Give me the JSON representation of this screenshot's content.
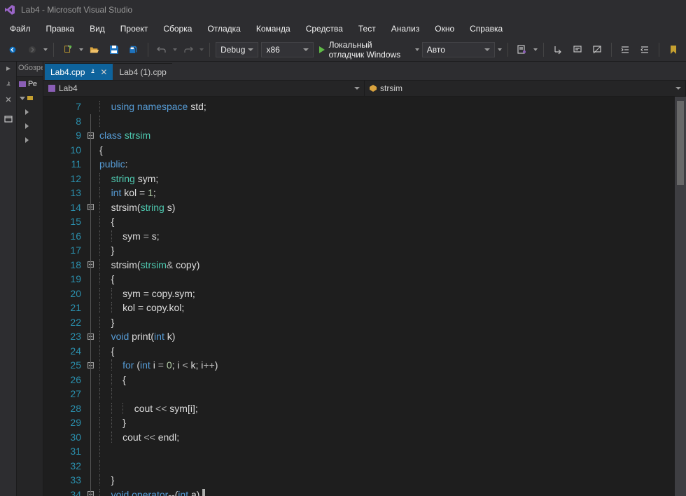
{
  "title": "Lab4 - Microsoft Visual Studio",
  "menu": [
    "Файл",
    "Правка",
    "Вид",
    "Проект",
    "Сборка",
    "Отладка",
    "Команда",
    "Средства",
    "Тест",
    "Анализ",
    "Окно",
    "Справка"
  ],
  "toolbar": {
    "config": "Debug",
    "platform": "x86",
    "debug_label": "Локальный отладчик Windows",
    "auto_label": "Авто"
  },
  "side_labels": {
    "explorer": "Обозре"
  },
  "solution": {
    "row1": "Ре"
  },
  "tabs": [
    {
      "label": "Lab4.cpp",
      "active": true,
      "pinned": true
    },
    {
      "label": "Lab4 (1).cpp",
      "active": false,
      "pinned": false
    }
  ],
  "nav": {
    "scope": "Lab4",
    "member": "strsim"
  },
  "code": {
    "start": 7,
    "lines": [
      {
        "n": 7,
        "fold": "",
        "ind": 1,
        "tokens": [
          [
            "kw",
            "using"
          ],
          [
            "",
            ""
          ],
          [
            "kw",
            "namespace"
          ],
          [
            "",
            ""
          ],
          [
            "id",
            "std"
          ],
          [
            "punc",
            ";"
          ]
        ]
      },
      {
        "n": 8,
        "fold": "line",
        "ind": 1,
        "tokens": []
      },
      {
        "n": 9,
        "fold": "box",
        "ind": 0,
        "tokens": [
          [
            "kw",
            "class"
          ],
          [
            "",
            ""
          ],
          [
            "type",
            "strsim"
          ]
        ]
      },
      {
        "n": 10,
        "fold": "line",
        "ind": 0,
        "tokens": [
          [
            "punc",
            "{"
          ]
        ]
      },
      {
        "n": 11,
        "fold": "line",
        "ind": 0,
        "tokens": [
          [
            "kw",
            "public"
          ],
          [
            "punc",
            ":"
          ]
        ]
      },
      {
        "n": 12,
        "fold": "line",
        "ind": 1,
        "tokens": [
          [
            "type",
            "string"
          ],
          [
            "",
            ""
          ],
          [
            "id",
            "sym"
          ],
          [
            "punc",
            ";"
          ]
        ]
      },
      {
        "n": 13,
        "fold": "line",
        "ind": 1,
        "tokens": [
          [
            "kw",
            "int"
          ],
          [
            "",
            ""
          ],
          [
            "id",
            "kol"
          ],
          [
            "",
            ""
          ],
          [
            "op",
            "="
          ],
          [
            "",
            ""
          ],
          [
            "num",
            "1"
          ],
          [
            "punc",
            ";"
          ]
        ]
      },
      {
        "n": 14,
        "fold": "box",
        "ind": 1,
        "tokens": [
          [
            "id",
            "strsim"
          ],
          [
            "punc",
            "("
          ],
          [
            "type",
            "string"
          ],
          [
            "",
            ""
          ],
          [
            "id",
            "s"
          ],
          [
            "punc",
            ")"
          ]
        ]
      },
      {
        "n": 15,
        "fold": "line",
        "ind": 1,
        "tokens": [
          [
            "punc",
            "{"
          ]
        ]
      },
      {
        "n": 16,
        "fold": "line",
        "ind": 2,
        "tokens": [
          [
            "id",
            "sym"
          ],
          [
            "",
            ""
          ],
          [
            "op",
            "="
          ],
          [
            "",
            ""
          ],
          [
            "id",
            "s"
          ],
          [
            "punc",
            ";"
          ]
        ]
      },
      {
        "n": 17,
        "fold": "line",
        "ind": 1,
        "tokens": [
          [
            "punc",
            "}"
          ]
        ]
      },
      {
        "n": 18,
        "fold": "box",
        "ind": 1,
        "tokens": [
          [
            "id",
            "strsim"
          ],
          [
            "punc",
            "("
          ],
          [
            "type",
            "strsim"
          ],
          [
            "op",
            "&"
          ],
          [
            "",
            ""
          ],
          [
            "id",
            "copy"
          ],
          [
            "punc",
            ")"
          ]
        ]
      },
      {
        "n": 19,
        "fold": "line",
        "ind": 1,
        "tokens": [
          [
            "punc",
            "{"
          ]
        ]
      },
      {
        "n": 20,
        "fold": "line",
        "ind": 2,
        "tokens": [
          [
            "id",
            "sym"
          ],
          [
            "",
            ""
          ],
          [
            "op",
            "="
          ],
          [
            "",
            ""
          ],
          [
            "id",
            "copy"
          ],
          [
            "punc",
            "."
          ],
          [
            "id",
            "sym"
          ],
          [
            "punc",
            ";"
          ]
        ]
      },
      {
        "n": 21,
        "fold": "line",
        "ind": 2,
        "tokens": [
          [
            "id",
            "kol"
          ],
          [
            "",
            ""
          ],
          [
            "op",
            "="
          ],
          [
            "",
            ""
          ],
          [
            "id",
            "copy"
          ],
          [
            "punc",
            "."
          ],
          [
            "id",
            "kol"
          ],
          [
            "punc",
            ";"
          ]
        ]
      },
      {
        "n": 22,
        "fold": "line",
        "ind": 1,
        "tokens": [
          [
            "punc",
            "}"
          ]
        ]
      },
      {
        "n": 23,
        "fold": "box",
        "ind": 1,
        "tokens": [
          [
            "kw",
            "void"
          ],
          [
            "",
            ""
          ],
          [
            "id",
            "print"
          ],
          [
            "punc",
            "("
          ],
          [
            "kw",
            "int"
          ],
          [
            "",
            ""
          ],
          [
            "id",
            "k"
          ],
          [
            "punc",
            ")"
          ]
        ]
      },
      {
        "n": 24,
        "fold": "line",
        "ind": 1,
        "tokens": [
          [
            "punc",
            "{"
          ]
        ]
      },
      {
        "n": 25,
        "fold": "box",
        "ind": 2,
        "tokens": [
          [
            "kw",
            "for"
          ],
          [
            "",
            ""
          ],
          [
            "punc",
            "("
          ],
          [
            "kw",
            "int"
          ],
          [
            "",
            ""
          ],
          [
            "id",
            "i"
          ],
          [
            "",
            ""
          ],
          [
            "op",
            "="
          ],
          [
            "",
            ""
          ],
          [
            "num",
            "0"
          ],
          [
            "punc",
            ";"
          ],
          [
            "",
            ""
          ],
          [
            "id",
            "i"
          ],
          [
            "",
            ""
          ],
          [
            "op",
            "<"
          ],
          [
            "",
            ""
          ],
          [
            "id",
            "k"
          ],
          [
            "punc",
            ";"
          ],
          [
            "",
            ""
          ],
          [
            "id",
            "i"
          ],
          [
            "op",
            "++"
          ],
          [
            "punc",
            ")"
          ]
        ]
      },
      {
        "n": 26,
        "fold": "line",
        "ind": 2,
        "tokens": [
          [
            "punc",
            "{"
          ]
        ]
      },
      {
        "n": 27,
        "fold": "line",
        "ind": 2,
        "tokens": []
      },
      {
        "n": 28,
        "fold": "line",
        "ind": 3,
        "tokens": [
          [
            "id",
            "cout"
          ],
          [
            "",
            ""
          ],
          [
            "op",
            "<<"
          ],
          [
            "",
            ""
          ],
          [
            "id",
            "sym"
          ],
          [
            "punc",
            "["
          ],
          [
            "id",
            "i"
          ],
          [
            "punc",
            "]"
          ],
          [
            "punc",
            ";"
          ]
        ]
      },
      {
        "n": 29,
        "fold": "line",
        "ind": 2,
        "tokens": [
          [
            "punc",
            "}"
          ]
        ]
      },
      {
        "n": 30,
        "fold": "line",
        "ind": 2,
        "tokens": [
          [
            "id",
            "cout"
          ],
          [
            "",
            ""
          ],
          [
            "op",
            "<<"
          ],
          [
            "",
            ""
          ],
          [
            "id",
            "endl"
          ],
          [
            "punc",
            ";"
          ]
        ]
      },
      {
        "n": 31,
        "fold": "line",
        "ind": 1,
        "tokens": []
      },
      {
        "n": 32,
        "fold": "line",
        "ind": 1,
        "tokens": []
      },
      {
        "n": 33,
        "fold": "line",
        "ind": 1,
        "tokens": [
          [
            "punc",
            "}"
          ]
        ]
      },
      {
        "n": 34,
        "fold": "box",
        "ind": 1,
        "tokens": [
          [
            "kw",
            "void"
          ],
          [
            "",
            ""
          ],
          [
            "kw",
            "operator"
          ],
          [
            "op",
            "--"
          ],
          [
            "punc",
            "("
          ],
          [
            "kw",
            "int"
          ],
          [
            "",
            ""
          ],
          [
            "id",
            "a"
          ],
          [
            "punc",
            ")"
          ],
          [
            "",
            ""
          ],
          [
            "cursor",
            "|"
          ]
        ]
      }
    ]
  }
}
